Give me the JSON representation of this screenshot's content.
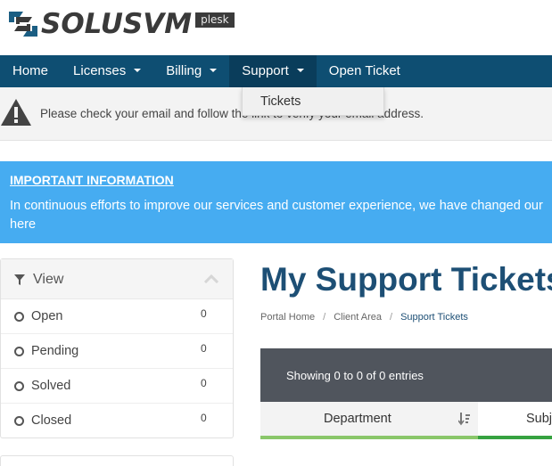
{
  "brand": {
    "name": "SOLUSVM",
    "tag": "plesk"
  },
  "nav": {
    "items": [
      {
        "label": "Home",
        "has_caret": false
      },
      {
        "label": "Licenses",
        "has_caret": true
      },
      {
        "label": "Billing",
        "has_caret": true
      },
      {
        "label": "Support",
        "has_caret": true
      },
      {
        "label": "Open Ticket",
        "has_caret": false
      }
    ],
    "active": "Support"
  },
  "dropdown": {
    "items": [
      "Tickets"
    ]
  },
  "alert": {
    "icon": "warning-icon",
    "text": "Please check your email and follow the link to verify your email address."
  },
  "info": {
    "title": "IMPORTANT INFORMATION",
    "body": "In continuous efforts to improve our services and customer experience, we have changed our",
    "link": "here",
    "background": "#46acf1"
  },
  "view_panel": {
    "title": "View",
    "icon": "filter-icon",
    "filters": [
      {
        "label": "Open",
        "count": "0"
      },
      {
        "label": "Pending",
        "count": "0"
      },
      {
        "label": "Solved",
        "count": "0"
      },
      {
        "label": "Closed",
        "count": "0"
      }
    ]
  },
  "main": {
    "title": "My Support Tickets",
    "breadcrumb": [
      "Portal Home",
      "Client Area",
      "Support Tickets"
    ],
    "showing": "Showing 0 to 0 of 0 entries",
    "columns": [
      "Department",
      "Subject"
    ]
  },
  "colors": {
    "navbar": "#0e4e72",
    "title": "#1d4f75",
    "toolbar": "#50555d",
    "accent_green": "#8ac76a"
  }
}
